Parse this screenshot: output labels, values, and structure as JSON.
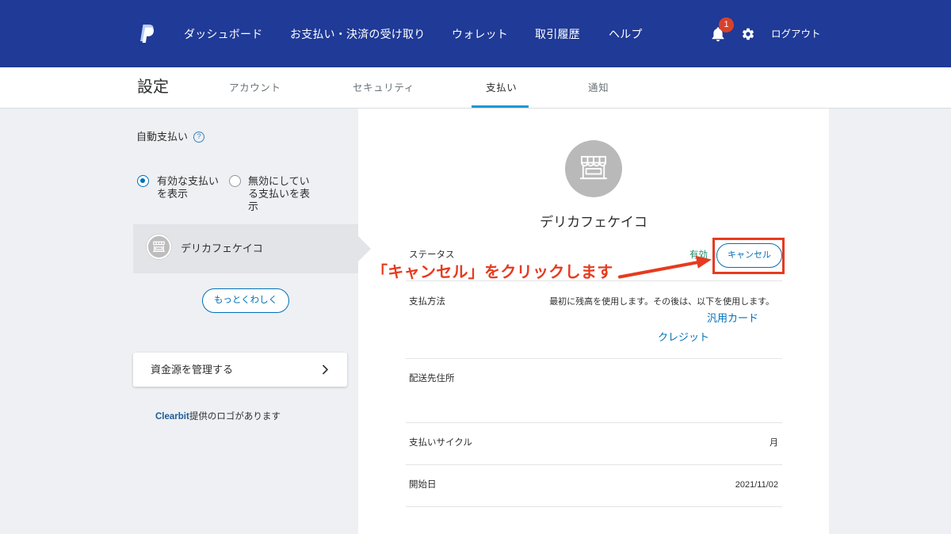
{
  "nav": {
    "logo_icon": "paypal-logo-icon",
    "items": [
      {
        "label": "ダッシュボード"
      },
      {
        "label": "お支払い・決済の受け取り"
      },
      {
        "label": "ウォレット"
      },
      {
        "label": "取引履歴"
      },
      {
        "label": "ヘルプ"
      }
    ],
    "notifications": {
      "icon": "bell-icon",
      "count": "1"
    },
    "settings_icon": "gear-icon",
    "logout_label": "ログアウト"
  },
  "settings": {
    "title": "設定",
    "tabs": [
      {
        "label": "アカウント",
        "active": false
      },
      {
        "label": "セキュリティ",
        "active": false
      },
      {
        "label": "支払い",
        "active": true
      },
      {
        "label": "通知",
        "active": false
      }
    ]
  },
  "sidebar": {
    "section_title": "自動支払い",
    "help_icon": "question-circle-icon",
    "filters": [
      {
        "label": "有効な支払いを表示",
        "selected": true
      },
      {
        "label": "無効にしている支払いを表示",
        "selected": false
      }
    ],
    "merchants": [
      {
        "name": "デリカフェケイコ",
        "icon": "store-icon",
        "selected": true
      }
    ],
    "learn_more_label": "もっとくわしく",
    "manage_funding_label": "資金源を管理する",
    "manage_funding_icon": "chevron-right-icon",
    "clearbit_brand": "Clearbit",
    "clearbit_note": "提供のロゴがあります"
  },
  "detail": {
    "merchant_name": "デリカフェケイコ",
    "merchant_icon": "store-icon",
    "status": {
      "label": "ステータス",
      "value": "有効",
      "cancel_label": "キャンセル"
    },
    "payment_method": {
      "label": "支払方法",
      "description": "最初に残高を使用します。その後は、以下を使用します。",
      "methods": [
        "汎用カード",
        "クレジット"
      ]
    },
    "shipping_address": {
      "label": "配送先住所"
    },
    "billing_cycle": {
      "label": "支払いサイクル",
      "value": "月"
    },
    "start_date": {
      "label": "開始日",
      "value": "2021/11/02"
    }
  },
  "annotation": {
    "text": "「キャンセル」をクリックします",
    "icon": "arrow-right-icon"
  },
  "colors": {
    "nav_bg": "#1f3a97",
    "page_bg": "#eef0f3",
    "accent": "#0070ba",
    "active_tab": "#1a9ad6",
    "status_active": "#1f8a6a",
    "badge": "#d9412b",
    "annotation": "#e63b1f",
    "selected_item": "#e2e4e7"
  }
}
